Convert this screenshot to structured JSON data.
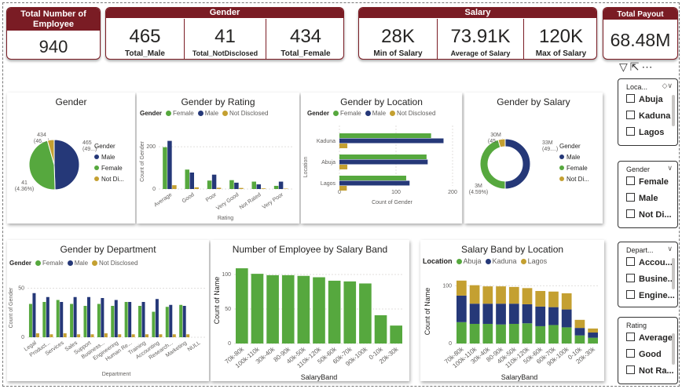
{
  "kpis": {
    "total_employees": {
      "title": "Total Number of Employee",
      "value": "940"
    },
    "gender": {
      "title": "Gender",
      "cells": [
        {
          "value": "465",
          "label": "Total_Male"
        },
        {
          "value": "41",
          "label": "Total_NotDisclosed"
        },
        {
          "value": "434",
          "label": "Total_Female"
        }
      ]
    },
    "salary": {
      "title": "Salary",
      "cells": [
        {
          "value": "28K",
          "label": "Min of Salary"
        },
        {
          "value": "73.91K",
          "label": "Average of Salary"
        },
        {
          "value": "120K",
          "label": "Max of Salary"
        }
      ]
    },
    "payout": {
      "title": "Total Payout",
      "value": "68.48M"
    }
  },
  "colors": {
    "male": "#253878",
    "female": "#56a83e",
    "not_disclosed": "#c4a031",
    "brand": "#7a1c24"
  },
  "icons": [
    "filter-icon",
    "focus-mode-icon",
    "more-options-icon"
  ],
  "chart_data": [
    {
      "id": "gender_pie",
      "type": "pie",
      "title": "Gender",
      "legend_title": "Gender",
      "legend_items": [
        "Male",
        "Female",
        "Not Di..."
      ],
      "slices": [
        {
          "name": "Male",
          "value": 465,
          "label": "465",
          "sublabel": "(49...)"
        },
        {
          "name": "Female",
          "value": 434,
          "label": "434",
          "sublabel": "(46....)"
        },
        {
          "name": "Not Disclosed",
          "value": 41,
          "label": "41",
          "sublabel": "(4.36%)"
        }
      ]
    },
    {
      "id": "gender_rating",
      "type": "bar",
      "title": "Gender by Rating",
      "legend_title": "Gender",
      "legend_items": [
        "Female",
        "Male",
        "Not Disclosed"
      ],
      "categories": [
        "Average",
        "Good",
        "Poor",
        "Very Good",
        "Not Rated",
        "Very Poor"
      ],
      "series": [
        {
          "name": "Female",
          "values": [
            198,
            92,
            40,
            42,
            35,
            15
          ]
        },
        {
          "name": "Male",
          "values": [
            228,
            78,
            68,
            30,
            22,
            35
          ]
        },
        {
          "name": "Not Disclosed",
          "values": [
            18,
            8,
            6,
            5,
            3,
            2
          ]
        }
      ],
      "xlabel": "Rating",
      "ylabel": "Count of Gender",
      "ylim": [
        0,
        260
      ],
      "yticks": [
        "0",
        "200"
      ]
    },
    {
      "id": "gender_location",
      "type": "bar",
      "orientation": "horizontal",
      "title": "Gender by Location",
      "legend_title": "Gender",
      "legend_items": [
        "Female",
        "Male",
        "Not Disclosed"
      ],
      "categories": [
        "Kaduna",
        "Abuja",
        "Lagos"
      ],
      "series": [
        {
          "name": "Female",
          "values": [
            162,
            154,
            118
          ]
        },
        {
          "name": "Male",
          "values": [
            184,
            156,
            124
          ]
        },
        {
          "name": "Not Disclosed",
          "values": [
            14,
            14,
            13
          ]
        }
      ],
      "xlabel": "Count of Gender",
      "ylabel": "Location",
      "xlim": [
        0,
        200
      ],
      "xticks": [
        "0",
        "100",
        "200"
      ]
    },
    {
      "id": "gender_salary",
      "type": "pie",
      "donut": true,
      "title": "Gender by Salary",
      "legend_title": "Gender",
      "legend_items": [
        "Male",
        "Female",
        "Not Di..."
      ],
      "slices": [
        {
          "name": "Male",
          "value": 33,
          "label": "33M",
          "sublabel": "(49....)"
        },
        {
          "name": "Female",
          "value": 30,
          "label": "30M",
          "sublabel": "(45....)"
        },
        {
          "name": "Not Disclosed",
          "value": 3,
          "label": "3M",
          "sublabel": "(4.59%)"
        }
      ]
    },
    {
      "id": "gender_dept",
      "type": "bar",
      "title": "Gender by Department",
      "legend_title": "Gender",
      "legend_items": [
        "Female",
        "Male",
        "Not Disclosed"
      ],
      "categories": [
        "Legal",
        "Product...",
        "Services",
        "Sales",
        "Support",
        "Business...",
        "Engineering",
        "Human Re...",
        "Training",
        "Accounting",
        "Research...",
        "Marketing",
        "NULL"
      ],
      "series": [
        {
          "name": "Female",
          "values": [
            34,
            36,
            38,
            34,
            32,
            34,
            32,
            36,
            32,
            26,
            31,
            33,
            0
          ]
        },
        {
          "name": "Male",
          "values": [
            45,
            41,
            36,
            41,
            41,
            40,
            38,
            36,
            36,
            39,
            33,
            32,
            0
          ]
        },
        {
          "name": "Not Disclosed",
          "values": [
            4,
            3,
            4,
            3,
            3,
            4,
            3,
            3,
            3,
            3,
            3,
            3,
            0
          ]
        }
      ],
      "xlabel": "Department",
      "ylabel": "Count of Gender",
      "ylim": [
        0,
        60
      ],
      "yticks": [
        "0",
        "50"
      ]
    },
    {
      "id": "salary_band",
      "type": "bar",
      "title": "Number of Employee by Salary Band",
      "categories": [
        "70k-80k",
        "100k-110k",
        "30k-40k",
        "80-90k",
        "40k-50k",
        "110k-120k",
        "50k-60k",
        "60k-70k",
        "90k-100k",
        "0-10k",
        "20k-30k"
      ],
      "values": [
        109,
        101,
        99,
        99,
        98,
        96,
        91,
        90,
        87,
        41,
        26
      ],
      "xlabel": "SalaryBand",
      "ylabel": "Count of Name",
      "ylim": [
        0,
        125
      ],
      "yticks": [
        "0",
        "50",
        "100"
      ]
    },
    {
      "id": "band_location",
      "type": "bar",
      "stacked": true,
      "title": "Salary Band by Location",
      "legend_title": "Location",
      "legend_items": [
        "Abuja",
        "Kaduna",
        "Lagos"
      ],
      "categories": [
        "70k-80k",
        "100k-110k",
        "30k-40k",
        "80-90k",
        "40k-50k",
        "110k-120k",
        "50k-60k",
        "60k-70k",
        "90k-100k",
        "0-10k",
        "20k-30k"
      ],
      "series": [
        {
          "name": "Abuja",
          "values": [
            37,
            34,
            34,
            33,
            34,
            35,
            30,
            32,
            28,
            14,
            10
          ]
        },
        {
          "name": "Kaduna",
          "values": [
            46,
            35,
            35,
            36,
            35,
            33,
            34,
            31,
            31,
            13,
            9
          ]
        },
        {
          "name": "Lagos",
          "values": [
            26,
            32,
            30,
            30,
            29,
            28,
            27,
            27,
            28,
            14,
            7
          ]
        }
      ],
      "xlabel": "SalaryBand",
      "ylabel": "Count of Name",
      "ylim": [
        0,
        125
      ],
      "yticks": [
        "0",
        "100"
      ]
    }
  ],
  "slicers": [
    {
      "title": "Loca...",
      "items": [
        "Abuja",
        "Kaduna",
        "Lagos"
      ]
    },
    {
      "title": "Gender",
      "items": [
        "Female",
        "Male",
        "Not Di..."
      ]
    },
    {
      "title": "Depart...",
      "items": [
        "Accou...",
        "Busine...",
        "Engine..."
      ]
    },
    {
      "title": "Rating",
      "items": [
        "Average",
        "Good",
        "Not Ra..."
      ]
    }
  ]
}
